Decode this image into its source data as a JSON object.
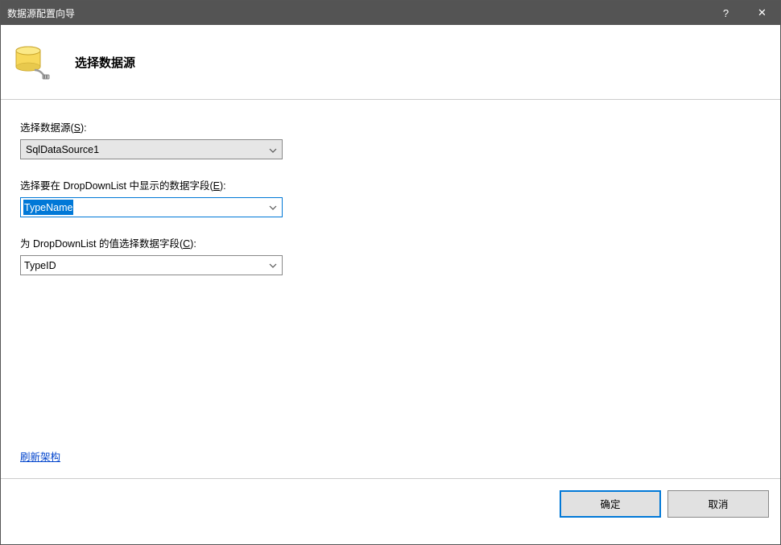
{
  "window": {
    "title": "数据源配置向导",
    "help": "?",
    "close": "✕"
  },
  "header": {
    "title": "选择数据源"
  },
  "fields": {
    "dataSource": {
      "label_pre": "选择数据源(",
      "label_key": "S",
      "label_post": "):",
      "value": "SqlDataSource1"
    },
    "displayField": {
      "label_pre": "选择要在 DropDownList 中显示的数据字段(",
      "label_key": "E",
      "label_post": "):",
      "value": "TypeName"
    },
    "valueField": {
      "label_pre": "为 DropDownList 的值选择数据字段(",
      "label_key": "C",
      "label_post": "):",
      "value": "TypeID"
    }
  },
  "link": {
    "refreshSchema": "刷新架构"
  },
  "buttons": {
    "ok": "确定",
    "cancel": "取消"
  }
}
